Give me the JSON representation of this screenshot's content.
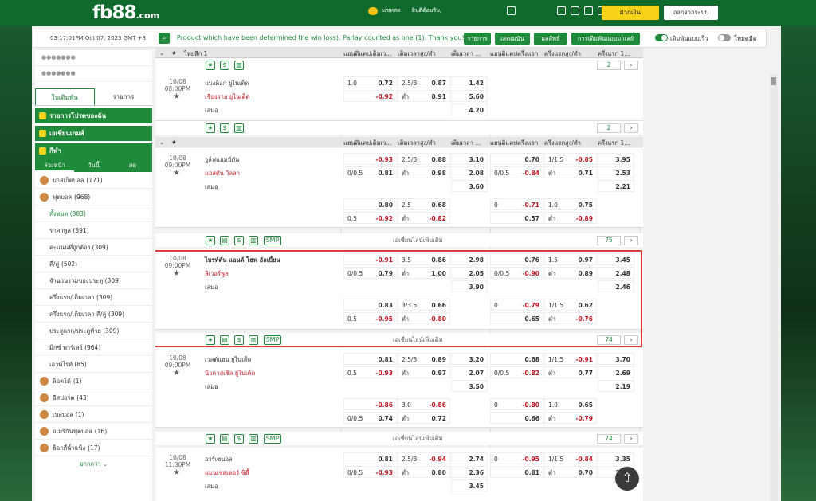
{
  "header": {
    "logo_main": "fb88",
    "logo_sub": ".com",
    "chat": "แชทสด",
    "welcome": "ยินดีต้อนรับ,",
    "deposit": "ฝากเงิน",
    "logout": "ออกจากระบบ"
  },
  "infobar": {
    "time": "03:17:01PM Oct 07, 2023 GMT +8",
    "ticker": "Product which have been determined the win loss). Parlay counted as one (1). Thank you!",
    "btn_list": "รายการ",
    "btn_bets": "เสตเมนัน",
    "btn_results": "ผลลัพธ์",
    "btn_settings": "การเดิมพันแบบมาเลย์",
    "toggle1": "เดิมพันแบบเร็ว",
    "toggle2": "โหมดมืด"
  },
  "left": {
    "tab_bets": "ใบเดิมพัน",
    "tab_list": "รายการ",
    "sec1": "รายการโปรดของฉัน",
    "sec2": "เอเชี่ยนเกมส์",
    "sec3": "กีฬา",
    "sub_today": "ล่วงหน้า",
    "sub_live": "วันนี้",
    "sub_early": "สด",
    "sports": [
      {
        "label": "บาสเก็ตบอล",
        "count": "(171)"
      },
      {
        "label": "ฟุตบอล",
        "count": "(968)"
      }
    ],
    "subitems": [
      "ทั้งหมด (883)",
      "ราคาพูล (391)",
      "คะแนนที่ถูกต้อง (309)",
      "คี่/คู่ (502)",
      "จำนวนรวมของประตู (309)",
      "ครึ่งแรก/เต็มเวลา (309)",
      "ครึ่งแรก/เต็มเวลา คี่/คู่ (309)",
      "ประตูแรก/ประตูท้าย (309)",
      "มิกซ์ พาร์เลย์ (964)",
      "เอาท์ไรท์ (85)"
    ],
    "sports2": [
      {
        "label": "ล็อตโต้",
        "count": "(1)"
      },
      {
        "label": "อีสปอร์ต",
        "count": "(43)"
      },
      {
        "label": "เบสบอล",
        "count": "(1)"
      },
      {
        "label": "อเมริกันฟุตบอล",
        "count": "(16)"
      },
      {
        "label": "ฮ็อกกี้น้ำแข็ง",
        "count": "(17)"
      }
    ],
    "more": "มากกว่า"
  },
  "columns": {
    "ft_hdp": "แฮนดิแคปเต็มเว...",
    "ft_ou": "เต็มเวลาสูง/ต่ำ",
    "ft_1x2": "เต็มเวลา ...",
    "h1_hdp": "แฮนดิแคปครึ่งแรก",
    "h1_ou": "ครึ่งแรกสูง/ต่ำ",
    "h1_1x2": "ครึ่งแรก 1..."
  },
  "leagues": [
    {
      "name": "ไทยลีก 1"
    },
    {
      "name": "พรีเมียร์ลีก อังกฤษ"
    }
  ],
  "matches": [
    {
      "date": "10/08",
      "time": "08:00PM",
      "home": "แบงค็อก ยูไนเต็ด",
      "away": "เชียงราย ยูไนเต็ด",
      "draw": "เสมอ",
      "more_count": "2"
    },
    {
      "date": "10/08",
      "time": "09:00PM",
      "home": "วูล์ฟแฮมป์ตัน",
      "away": "แอสตัน วิลลา",
      "draw": "เสมอ",
      "more_count": "75",
      "more_lines": "เอเชี่ยนไลน์เพิ่มเติม"
    },
    {
      "date": "10/08",
      "time": "09:00PM",
      "home": "ไบรท์ตัน แอนด์ โฮฟ อัลเบี้ยน",
      "away": "ลิเวอร์พูล",
      "draw": "เสมอ",
      "more_count": "74",
      "more_lines": "เอเชี่ยนไลน์เพิ่มเติม"
    },
    {
      "date": "10/08",
      "time": "09:00PM",
      "home": "เวสต์แฮม ยูไนเต็ด",
      "away": "นิวคาสเซิล ยูไนเต็ด",
      "draw": "เสมอ",
      "more_count": "74",
      "more_lines": "เอเชี่ยนไลน์เพิ่มเติม"
    },
    {
      "date": "10/08",
      "time": "11:30PM",
      "home": "อาร์เซนอล",
      "away": "แมนเชสเตอร์ ซิตี้",
      "draw": "เสมอ"
    }
  ],
  "odds": {
    "m0": [
      [
        "1.0",
        "0.72",
        "2.5/3",
        "0.87",
        "1.42"
      ],
      [
        "",
        "-0.92",
        "ต่ำ",
        "0.91",
        "5.60"
      ],
      [
        "",
        "",
        "",
        "",
        "4.20"
      ]
    ],
    "m1": [
      [
        "",
        "-0.93",
        "2.5/3",
        "0.88",
        "3.10",
        "",
        "0.70",
        "1/1.5",
        "-0.85",
        "3.95"
      ],
      [
        "0/0.5",
        "0.81",
        "ต่ำ",
        "0.98",
        "2.08",
        "0/0.5",
        "-0.84",
        "ต่ำ",
        "0.71",
        "2.53"
      ],
      [
        "",
        "",
        "",
        "",
        "3.60",
        "",
        "",
        "",
        "",
        "2.21"
      ],
      [
        "",
        "0.80",
        "2.5",
        "0.68",
        "",
        "0",
        "-0.71",
        "1.0",
        "0.75",
        ""
      ],
      [
        "0.5",
        "-0.92",
        "ต่ำ",
        "-0.82",
        "",
        "",
        "0.57",
        "ต่ำ",
        "-0.89",
        ""
      ]
    ],
    "m2": [
      [
        "",
        "-0.91",
        "3.5",
        "0.86",
        "2.98",
        "",
        "0.76",
        "1.5",
        "0.97",
        "3.45"
      ],
      [
        "0/0.5",
        "0.79",
        "ต่ำ",
        "1.00",
        "2.05",
        "0/0.5",
        "-0.90",
        "ต่ำ",
        "0.89",
        "2.48"
      ],
      [
        "",
        "",
        "",
        "",
        "3.90",
        "",
        "",
        "",
        "",
        "2.46"
      ],
      [
        "",
        "0.83",
        "3/3.5",
        "0.66",
        "",
        "0",
        "-0.79",
        "1/1.5",
        "0.62",
        ""
      ],
      [
        "0.5",
        "-0.95",
        "ต่ำ",
        "-0.80",
        "",
        "",
        "0.65",
        "ต่ำ",
        "-0.76",
        ""
      ]
    ],
    "m3": [
      [
        "",
        "0.81",
        "2.5/3",
        "0.89",
        "3.20",
        "",
        "0.68",
        "1/1.5",
        "-0.91",
        "3.70"
      ],
      [
        "0.5",
        "-0.93",
        "ต่ำ",
        "0.97",
        "2.07",
        "0/0.5",
        "-0.82",
        "ต่ำ",
        "0.77",
        "2.69"
      ],
      [
        "",
        "",
        "",
        "",
        "3.50",
        "",
        "",
        "",
        "",
        "2.19"
      ],
      [
        "",
        "-0.86",
        "3.0",
        "-0.86",
        "",
        "0",
        "-0.80",
        "1.0",
        "0.65",
        ""
      ],
      [
        "0/0.5",
        "0.74",
        "ต่ำ",
        "0.72",
        "",
        "",
        "0.66",
        "ต่ำ",
        "-0.79",
        ""
      ]
    ],
    "m4": [
      [
        "",
        "0.81",
        "2.5/3",
        "-0.94",
        "2.74",
        "0",
        "-0.95",
        "1/1.5",
        "-0.84",
        "3.35"
      ],
      [
        "0/0.5",
        "-0.93",
        "ต่ำ",
        "0.80",
        "2.36",
        "",
        "0.81",
        "ต่ำ",
        "0.70",
        "2.96"
      ],
      [
        "",
        "",
        "",
        "",
        "3.45",
        "",
        "",
        "",
        "",
        ""
      ]
    ]
  },
  "smp": "SMP"
}
